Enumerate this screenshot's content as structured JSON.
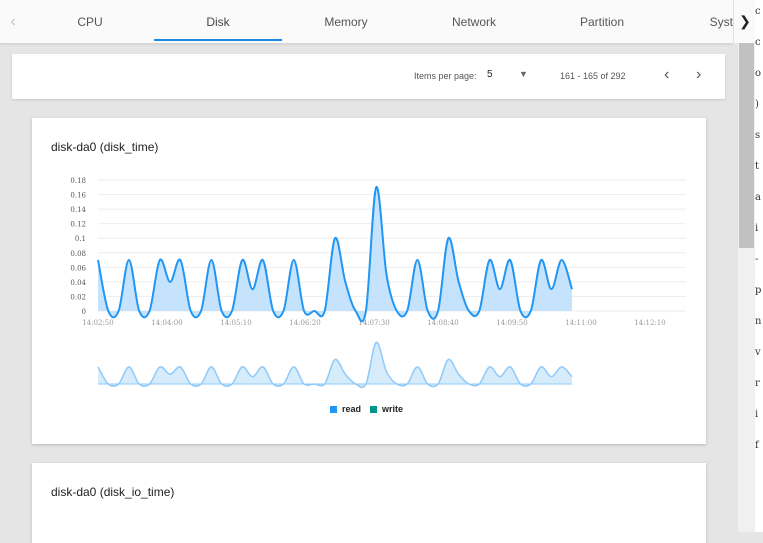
{
  "tabs": [
    {
      "label": "CPU"
    },
    {
      "label": "Disk",
      "active": true
    },
    {
      "label": "Memory"
    },
    {
      "label": "Network"
    },
    {
      "label": "Partition"
    },
    {
      "label": "Syst"
    }
  ],
  "pager": {
    "items_per_page_label": "Items per page:",
    "items_per_page": "5",
    "range": "161 - 165 of 292"
  },
  "cards": [
    {
      "title": "disk-da0 (disk_time)",
      "chart_data": {
        "type": "area",
        "title": "",
        "yticks": [
          "0.18",
          "0.16",
          "0.14",
          "0.12",
          "0.1",
          "0.08",
          "0.06",
          "0.04",
          "0.02",
          "0"
        ],
        "ylim": [
          0,
          0.18
        ],
        "xticks": [
          "14:02:50",
          "14:04:00",
          "14:05:10",
          "14:06:20",
          "14:07:30",
          "14:08:40",
          "14:09:50",
          "14:11:00",
          "14:12:10"
        ],
        "grid": true,
        "legend_position": "bottom",
        "series": [
          {
            "name": "read",
            "color": "#2196f3",
            "values": [
              0.07,
              0,
              0,
              0.07,
              0,
              0,
              0.07,
              0.04,
              0.07,
              0,
              0,
              0.07,
              0,
              0,
              0.07,
              0.03,
              0.07,
              0,
              0,
              0.07,
              0,
              0,
              0,
              0.1,
              0.04,
              0,
              0,
              0.17,
              0.05,
              0,
              0,
              0.07,
              0,
              0,
              0.1,
              0.04,
              0,
              0,
              0.07,
              0.03,
              0.07,
              0,
              0,
              0.07,
              0.03,
              0.07,
              0.03
            ]
          },
          {
            "name": "write",
            "color": "#009688",
            "values": []
          }
        ]
      }
    },
    {
      "title": "disk-da0 (disk_io_time)"
    }
  ],
  "side_strip_chars": [
    "c",
    "c",
    "o",
    ")",
    "s",
    "t",
    "a",
    "i",
    "-",
    "p",
    "n",
    "v",
    "r",
    "i",
    "f"
  ]
}
